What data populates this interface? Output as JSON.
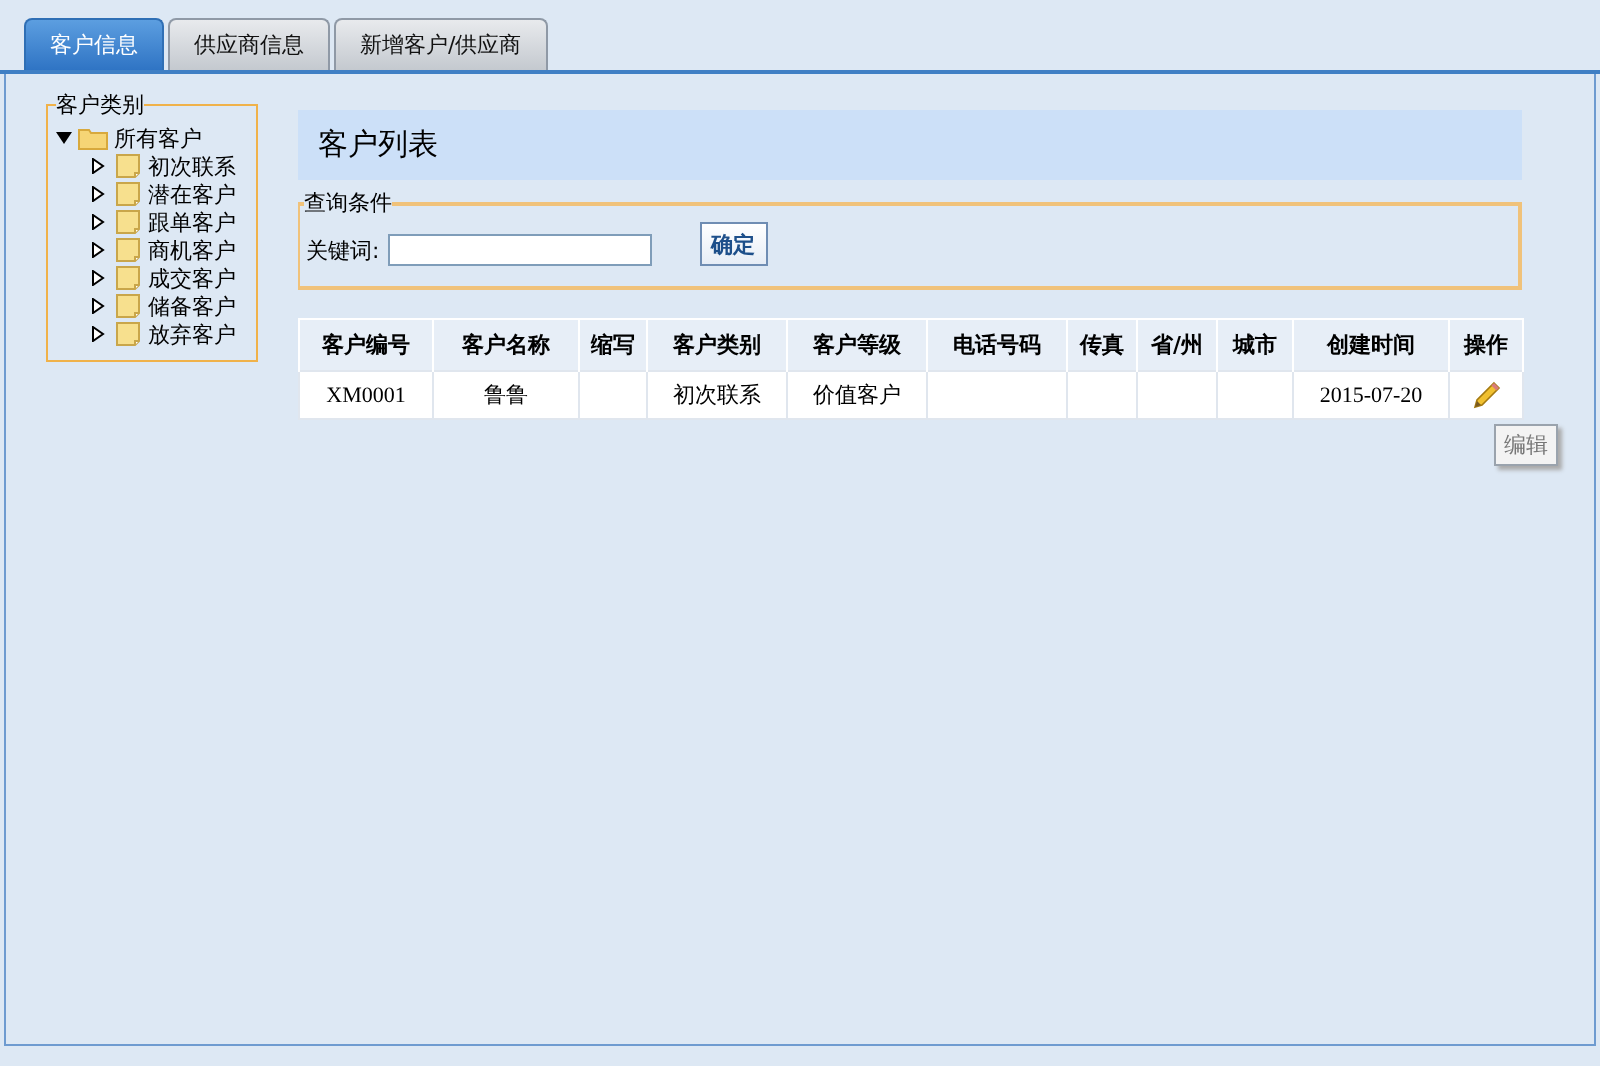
{
  "tabs": [
    {
      "label": "客户信息",
      "selected": true
    },
    {
      "label": "供应商信息",
      "selected": false
    },
    {
      "label": "新增客户/供应商",
      "selected": false
    }
  ],
  "category_panel": {
    "title": "客户类别",
    "tree": [
      {
        "label": "所有客户",
        "expanded": true,
        "children": [
          {
            "label": "初次联系",
            "expanded": false
          },
          {
            "label": "潜在客户",
            "expanded": false
          },
          {
            "label": "跟单客户",
            "expanded": false
          },
          {
            "label": "商机客户",
            "expanded": false
          },
          {
            "label": "成交客户",
            "expanded": false
          },
          {
            "label": "储备客户",
            "expanded": false
          },
          {
            "label": "放弃客户",
            "expanded": false
          }
        ]
      }
    ]
  },
  "list_title": "客户列表",
  "query": {
    "title": "查询条件",
    "keyword_label": "关键词:",
    "button": "确定"
  },
  "table": {
    "columns": [
      "客户编号",
      "客户名称",
      "缩写",
      "客户类别",
      "客户等级",
      "电话号码",
      "传真",
      "省/州",
      "城市",
      "创建时间",
      "操作"
    ],
    "rows": [
      [
        "XM0001",
        "鲁鲁",
        "",
        "初次联系",
        "价值客户",
        "",
        "",
        "",
        "",
        "2015-07-20"
      ]
    ]
  },
  "tooltip": "编辑"
}
